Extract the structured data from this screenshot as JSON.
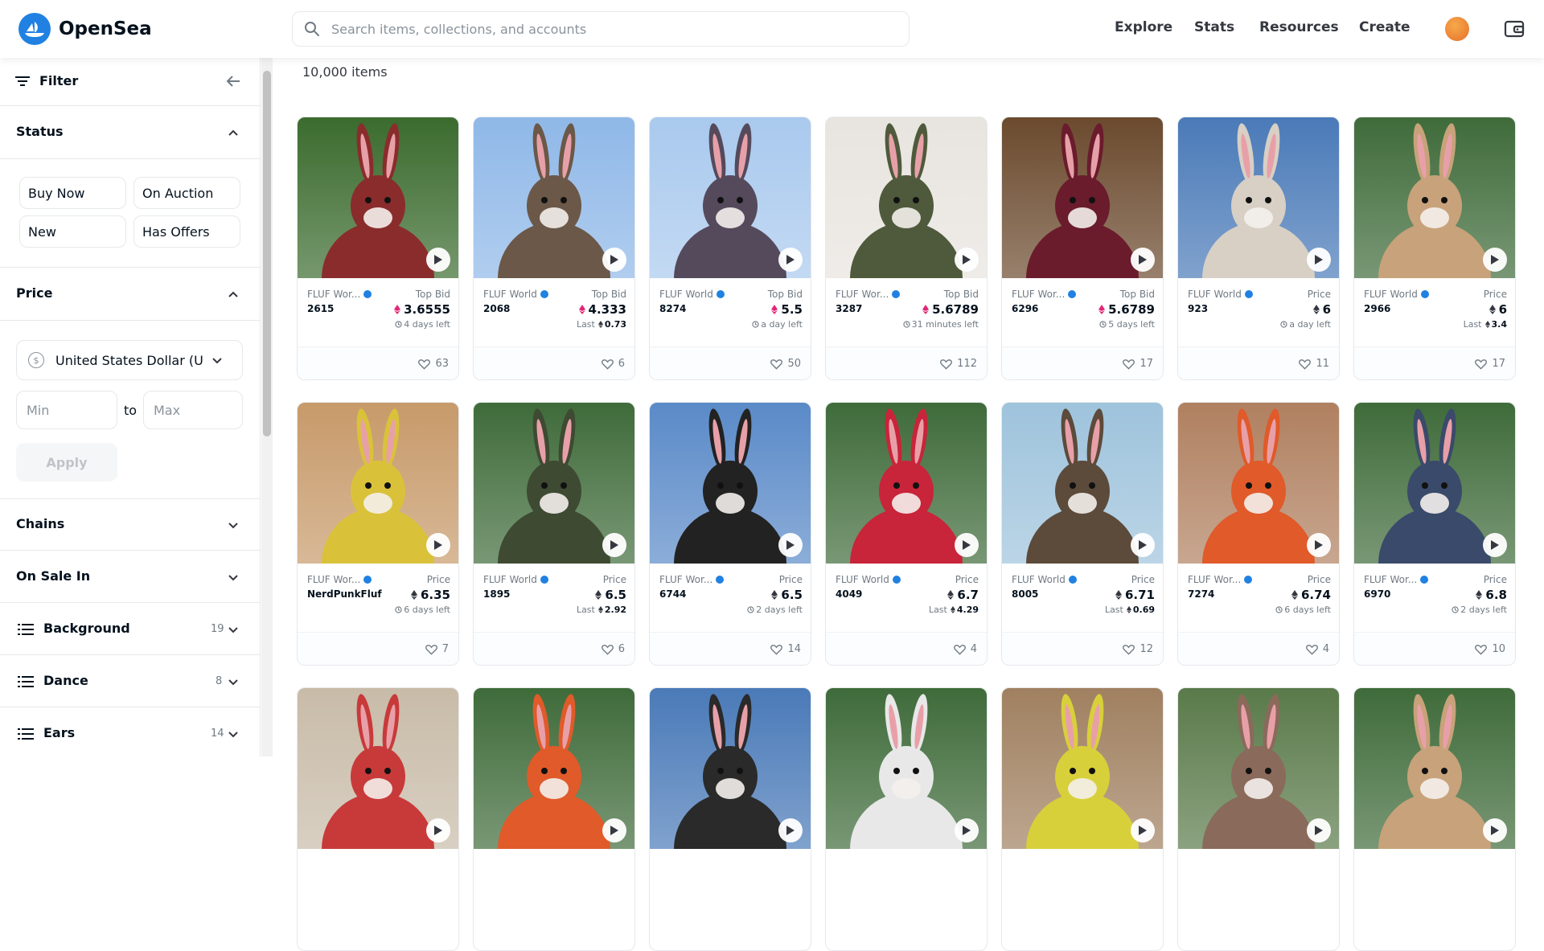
{
  "header": {
    "logo_text": "OpenSea",
    "search_placeholder": "Search items, collections, and accounts",
    "nav": [
      "Explore",
      "Stats",
      "Resources",
      "Create"
    ]
  },
  "sidebar": {
    "filter_label": "Filter",
    "status": {
      "title": "Status",
      "buttons": [
        "Buy Now",
        "On Auction",
        "New",
        "Has Offers"
      ]
    },
    "price": {
      "title": "Price",
      "currency": "United States Dollar (USD)",
      "min_placeholder": "Min",
      "max_placeholder": "Max",
      "to": "to",
      "apply": "Apply"
    },
    "sections": [
      "Chains",
      "On Sale In"
    ],
    "traits": [
      {
        "name": "Background",
        "count": "19"
      },
      {
        "name": "Dance",
        "count": "8"
      },
      {
        "name": "Ears",
        "count": "14"
      }
    ]
  },
  "main": {
    "item_count": "10,000 items",
    "cards": [
      {
        "collection": "FLUF Wor...",
        "id": "2615",
        "label": "Top Bid",
        "price": "3.6555",
        "token": "weth",
        "sub": "4 days left",
        "sub_type": "time",
        "likes": "63",
        "bg": [
          "#3b6b2e",
          "#8a2c2c"
        ]
      },
      {
        "collection": "FLUF World",
        "id": "2068",
        "label": "Top Bid",
        "price": "4.333",
        "token": "weth",
        "sub": "0.73",
        "sub_type": "last",
        "likes": "6",
        "bg": [
          "#8fb8e8",
          "#6b5848"
        ]
      },
      {
        "collection": "FLUF World",
        "id": "8274",
        "label": "Top Bid",
        "price": "5.5",
        "token": "weth",
        "sub": "a day left",
        "sub_type": "time",
        "likes": "50",
        "bg": [
          "#a9c9ee",
          "#554a5c"
        ]
      },
      {
        "collection": "FLUF Wor...",
        "id": "3287",
        "label": "Top Bid",
        "price": "5.6789",
        "token": "weth",
        "sub": "31 minutes left",
        "sub_type": "time",
        "likes": "112",
        "bg": [
          "#e8e4df",
          "#4f5a3c"
        ]
      },
      {
        "collection": "FLUF Wor...",
        "id": "6296",
        "label": "Top Bid",
        "price": "5.6789",
        "token": "weth",
        "sub": "5 days left",
        "sub_type": "time",
        "likes": "17",
        "bg": [
          "#6b4a2e",
          "#6a1c2c"
        ]
      },
      {
        "collection": "FLUF World",
        "id": "923",
        "label": "Price",
        "price": "6",
        "token": "eth",
        "sub": "a day left",
        "sub_type": "time",
        "likes": "11",
        "bg": [
          "#4a7ab8",
          "#d8cfc5"
        ]
      },
      {
        "collection": "FLUF World",
        "id": "2966",
        "label": "Price",
        "price": "6",
        "token": "eth",
        "sub": "3.4",
        "sub_type": "last",
        "likes": "17",
        "bg": [
          "#3f6b3a",
          "#c8a27a"
        ]
      },
      {
        "collection": "FLUF Wor...",
        "id": "NerdPunkFluf",
        "label": "Price",
        "price": "6.35",
        "token": "eth",
        "sub": "6 days left",
        "sub_type": "time",
        "likes": "7",
        "bg": [
          "#c79a6a",
          "#d9c23a"
        ]
      },
      {
        "collection": "FLUF World",
        "id": "1895",
        "label": "Price",
        "price": "6.5",
        "token": "eth",
        "sub": "2.92",
        "sub_type": "last",
        "likes": "6",
        "bg": [
          "#3f6b3a",
          "#3e4a32"
        ]
      },
      {
        "collection": "FLUF Wor...",
        "id": "6744",
        "label": "Price",
        "price": "6.5",
        "token": "eth",
        "sub": "2 days left",
        "sub_type": "time",
        "likes": "14",
        "bg": [
          "#5a8ac8",
          "#222222"
        ]
      },
      {
        "collection": "FLUF World",
        "id": "4049",
        "label": "Price",
        "price": "6.7",
        "token": "eth",
        "sub": "4.29",
        "sub_type": "last",
        "likes": "4",
        "bg": [
          "#3f6b3a",
          "#c8243a"
        ]
      },
      {
        "collection": "FLUF World",
        "id": "8005",
        "label": "Price",
        "price": "6.71",
        "token": "eth",
        "sub": "0.69",
        "sub_type": "last",
        "likes": "12",
        "bg": [
          "#9ec3dc",
          "#5c4a3a"
        ]
      },
      {
        "collection": "FLUF Wor...",
        "id": "7274",
        "label": "Price",
        "price": "6.74",
        "token": "eth",
        "sub": "6 days left",
        "sub_type": "time",
        "likes": "4",
        "bg": [
          "#b08060",
          "#e05a2a"
        ]
      },
      {
        "collection": "FLUF Wor...",
        "id": "6970",
        "label": "Price",
        "price": "6.8",
        "token": "eth",
        "sub": "2 days left",
        "sub_type": "time",
        "likes": "10",
        "bg": [
          "#3f6b3a",
          "#3a4a6a"
        ]
      },
      {
        "bg": [
          "#c8bba8",
          "#c83a3a"
        ]
      },
      {
        "bg": [
          "#3f6b3a",
          "#e05a2a"
        ]
      },
      {
        "bg": [
          "#4a7ab8",
          "#2a2a2a"
        ]
      },
      {
        "bg": [
          "#3f6b3a",
          "#e8e8e8"
        ]
      },
      {
        "bg": [
          "#a08060",
          "#d8d03a"
        ]
      },
      {
        "bg": [
          "#5a7a4a",
          "#8a6a5a"
        ]
      },
      {
        "bg": [
          "#3f6b3a",
          "#c8a27a"
        ]
      }
    ]
  }
}
